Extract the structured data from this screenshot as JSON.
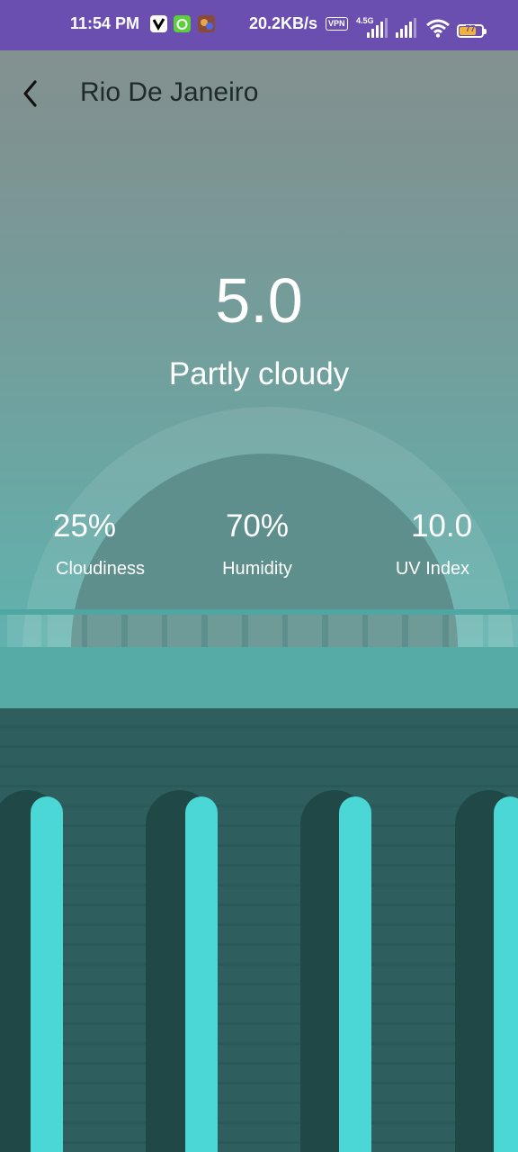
{
  "status_bar": {
    "time": "11:54 PM",
    "network_speed": "20.2KB/s",
    "vpn_label": "VPN",
    "network_type": "4.5G",
    "battery_level": "77",
    "battery_fraction": 0.77,
    "icons": [
      "v-app-icon",
      "alarm-app-icon",
      "game-app-icon",
      "signal-icon",
      "signal-icon",
      "wifi-icon",
      "battery-icon"
    ]
  },
  "header": {
    "back_icon": "back-arrow-icon",
    "city": "Rio De Janeiro"
  },
  "weather": {
    "temperature": "5.0",
    "condition": "Partly cloudy"
  },
  "stats": {
    "cloudiness": {
      "value": "25%",
      "label": "Cloudiness"
    },
    "humidity": {
      "value": "70%",
      "label": "Humidity"
    },
    "uv_index": {
      "value": "10.0",
      "label": "UV Index"
    }
  },
  "colors": {
    "status_bar": "#6a4fb0",
    "sky_top": "#86908f",
    "sky_bottom": "#5eb5b1",
    "wall": "#2e5f5e",
    "pillar_light": "#4bd7d6"
  }
}
